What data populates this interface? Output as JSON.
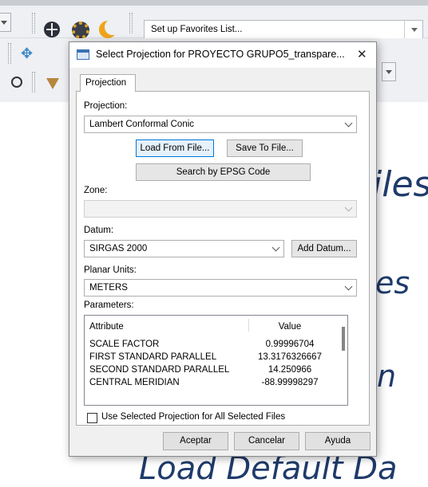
{
  "toolbar": {
    "favorites_value": "Set up Favorites List..."
  },
  "background": {
    "text_fragments": [
      "iles",
      "es",
      "n",
      "Load Default Da"
    ]
  },
  "dialog": {
    "title": "Select Projection for PROYECTO GRUPO5_transpare...",
    "close_symbol": "✕",
    "tab_label": "Projection",
    "projection_label": "Projection:",
    "projection_value": "Lambert Conformal Conic",
    "load_from_file": "Load From File...",
    "save_to_file": "Save To File...",
    "search_epsg": "Search by EPSG Code",
    "zone_label": "Zone:",
    "zone_value": "",
    "datum_label": "Datum:",
    "datum_value": "SIRGAS 2000",
    "add_datum": "Add Datum...",
    "planar_units_label": "Planar Units:",
    "planar_units_value": "METERS",
    "parameters_label": "Parameters:",
    "parameters": {
      "header_attribute": "Attribute",
      "header_value": "Value",
      "rows": [
        {
          "attribute": "SCALE FACTOR",
          "value": "0.99996704"
        },
        {
          "attribute": "FIRST STANDARD PARALLEL",
          "value": "13.3176326667"
        },
        {
          "attribute": "SECOND STANDARD PARALLEL",
          "value": "14.250966"
        },
        {
          "attribute": "CENTRAL MERIDIAN",
          "value": "-88.99998297"
        }
      ]
    },
    "use_selected_label": "Use Selected Projection for All Selected Files",
    "use_selected_checked": false,
    "accept": "Aceptar",
    "cancel": "Cancelar",
    "help": "Ayuda"
  }
}
